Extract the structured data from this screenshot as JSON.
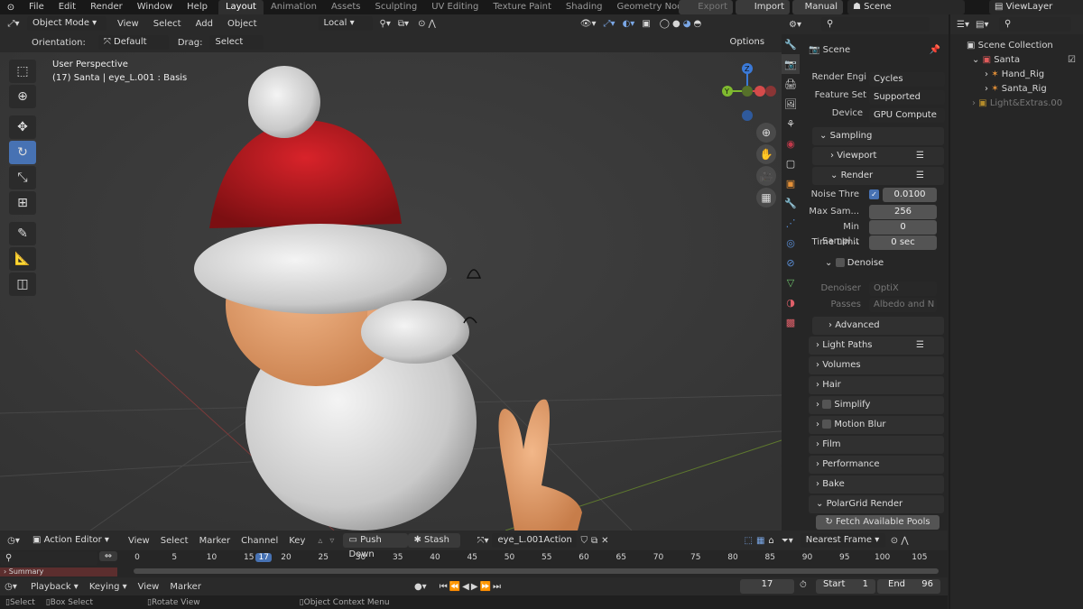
{
  "menus": [
    "File",
    "Edit",
    "Render",
    "Window",
    "Help"
  ],
  "workspaces": [
    "Layout",
    "Animation",
    "Assets",
    "Sculpting",
    "UV Editing",
    "Texture Paint",
    "Shading",
    "Geometry Nodes"
  ],
  "add_tab": "+",
  "top_right": {
    "export": "Export",
    "import": "Import",
    "manual": "Manual",
    "scene": "Scene",
    "viewlayer": "ViewLayer"
  },
  "viewport_header": {
    "mode": "Object Mode",
    "menus": [
      "View",
      "Select",
      "Add",
      "Object"
    ],
    "transform": "Local"
  },
  "viewport_header2": {
    "orientation_label": "Orientation:",
    "orientation": "Default",
    "drag_label": "Drag:",
    "drag": "Select Box",
    "options": "Options"
  },
  "viewport_info": {
    "line1": "User Perspective",
    "line2": "(17) Santa | eye_L.001 : Basis"
  },
  "gizmo": {
    "z": "Z",
    "y": "Y"
  },
  "properties": {
    "scene_name": "Scene",
    "render_engine_label": "Render Engi",
    "render_engine": "Cycles",
    "feature_set_label": "Feature Set",
    "feature_set": "Supported",
    "device_label": "Device",
    "device": "GPU Compute",
    "sampling": "Sampling",
    "viewport": "Viewport",
    "render": "Render",
    "noise_label": "Noise Thre",
    "noise_value": "0.0100",
    "max_label": "Max Sam...",
    "max_value": "256",
    "min_label": "Min Sampl...",
    "min_value": "0",
    "time_label": "Time Limit",
    "time_value": "0 sec",
    "denoise": "Denoise",
    "denoiser_label": "Denoiser",
    "denoiser": "OptiX",
    "passes_label": "Passes",
    "passes": "Albedo and N",
    "panels": [
      "Advanced",
      "Light Paths",
      "Volumes",
      "Hair",
      "Simplify",
      "Motion Blur",
      "Film",
      "Performance",
      "Bake",
      "PolarGrid Render"
    ],
    "fetch": "Fetch Available Pools"
  },
  "outliner": {
    "root": "Scene Collection",
    "items": [
      "Santa",
      "Hand_Rig",
      "Santa_Rig",
      "Light&Extras.00"
    ]
  },
  "action_editor": {
    "mode": "Action Editor",
    "menus": [
      "View",
      "Select",
      "Marker",
      "Channel",
      "Key"
    ],
    "push_down": "Push Down",
    "stash": "Stash",
    "action": "eye_L.001Action",
    "snap": "Nearest Frame",
    "summary": "Summary"
  },
  "ruler": {
    "frames": [
      "0",
      "5",
      "10",
      "15",
      "17",
      "20",
      "25",
      "30",
      "35",
      "40",
      "45",
      "50",
      "55",
      "60",
      "65",
      "70",
      "75",
      "80",
      "85",
      "90",
      "95",
      "100",
      "105"
    ],
    "current": "17"
  },
  "playback": {
    "playback": "Playback",
    "keying": "Keying",
    "view": "View",
    "marker": "Marker",
    "frame": "17",
    "start_label": "Start",
    "start": "1",
    "end_label": "End",
    "end": "96"
  },
  "status": {
    "select": "Select",
    "box_select": "Box Select",
    "rotate": "Rotate View",
    "context": "Object Context Menu"
  }
}
